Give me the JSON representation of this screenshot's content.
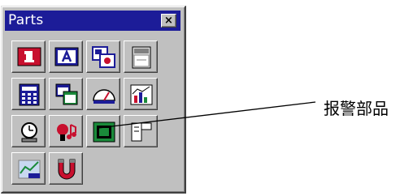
{
  "window": {
    "title": "Parts",
    "close_glyph": "×"
  },
  "parts": [
    {
      "icon": "lamp-1-icon"
    },
    {
      "icon": "text-a-icon"
    },
    {
      "icon": "bitmap-switch-icon"
    },
    {
      "icon": "tank-icon"
    },
    {
      "icon": "keypad-icon"
    },
    {
      "icon": "window-copy-icon"
    },
    {
      "icon": "meter-gauge-icon"
    },
    {
      "icon": "trend-chart-icon"
    },
    {
      "icon": "alarm-clock-icon"
    },
    {
      "icon": "alarm-siren-icon"
    },
    {
      "icon": "display-screen-icon"
    },
    {
      "icon": "data-transfer-icon"
    },
    {
      "icon": "graph-line-icon"
    },
    {
      "icon": "magnet-u-icon"
    }
  ],
  "callout": {
    "label": "报警部品",
    "target_icon": "alarm-siren-icon"
  },
  "colors": {
    "title_bar": "#1c1c98",
    "face": "#c0c0c0",
    "red": "#c8102e",
    "blue": "#1c1c98",
    "green": "#1a8a3a"
  }
}
